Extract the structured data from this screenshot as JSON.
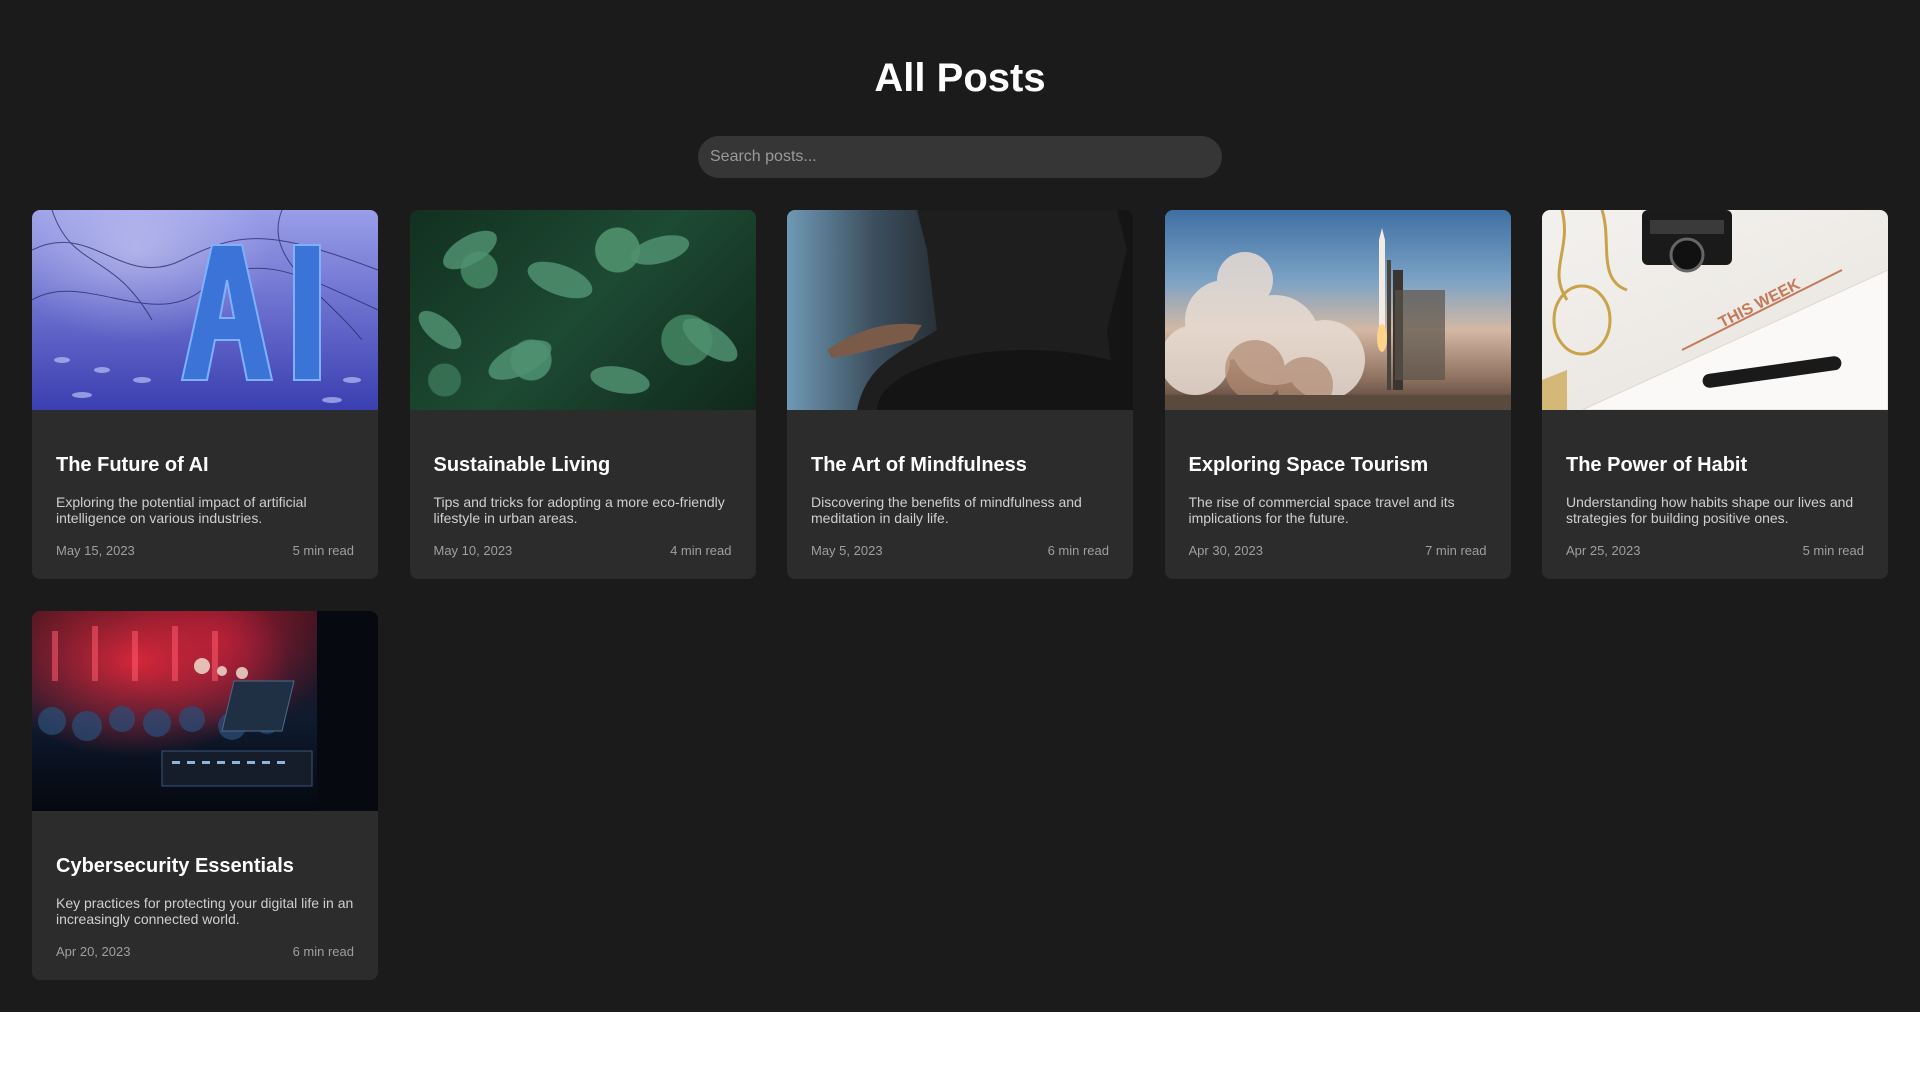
{
  "page": {
    "title": "All Posts"
  },
  "search": {
    "placeholder": "Search posts...",
    "value": ""
  },
  "posts": [
    {
      "title": "The Future of AI",
      "excerpt": "Exploring the potential impact of artificial intelligence on various industries.",
      "date": "May 15, 2023",
      "read_time": "5 min read",
      "image": "ai-letters-image"
    },
    {
      "title": "Sustainable Living",
      "excerpt": "Tips and tricks for adopting a more eco-friendly lifestyle in urban areas.",
      "date": "May 10, 2023",
      "read_time": "4 min read",
      "image": "green-leaves-image"
    },
    {
      "title": "The Art of Mindfulness",
      "excerpt": "Discovering the benefits of mindfulness and meditation in daily life.",
      "date": "May 5, 2023",
      "read_time": "6 min read",
      "image": "meditation-image"
    },
    {
      "title": "Exploring Space Tourism",
      "excerpt": "The rise of commercial space travel and its implications for the future.",
      "date": "Apr 30, 2023",
      "read_time": "7 min read",
      "image": "rocket-launch-image"
    },
    {
      "title": "The Power of Habit",
      "excerpt": "Understanding how habits shape our lives and strategies for building positive ones.",
      "date": "Apr 25, 2023",
      "read_time": "5 min read",
      "image": "weekly-planner-image",
      "image_text": "THIS WEEK"
    },
    {
      "title": "Cybersecurity Essentials",
      "excerpt": "Key practices for protecting your digital life in an increasingly connected world.",
      "date": "Apr 20, 2023",
      "read_time": "6 min read",
      "image": "conference-laptop-image"
    }
  ],
  "colors": {
    "background": "#1b1b1b",
    "card": "#2c2c2c",
    "search": "#363636",
    "text": "#ffffff",
    "muted": "#9f9f9f"
  }
}
